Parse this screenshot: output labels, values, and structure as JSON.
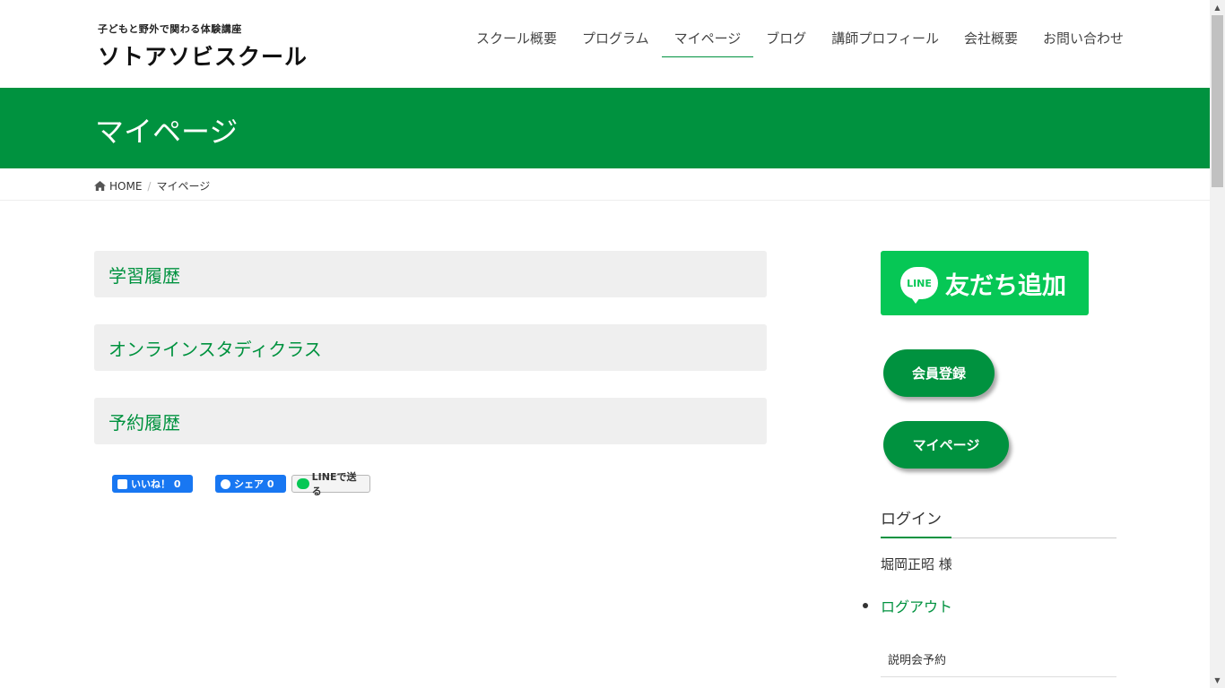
{
  "header": {
    "logo_sub": "子どもと野外で関わる体験講座",
    "logo_main": "ソトアソビスクール",
    "nav": [
      {
        "label": "スクール概要",
        "active": false
      },
      {
        "label": "プログラム",
        "active": false
      },
      {
        "label": "マイページ",
        "active": true
      },
      {
        "label": "ブログ",
        "active": false
      },
      {
        "label": "講師プロフィール",
        "active": false
      },
      {
        "label": "会社概要",
        "active": false
      },
      {
        "label": "お問い合わせ",
        "active": false
      }
    ]
  },
  "page_title": "マイページ",
  "breadcrumb": {
    "home": "HOME",
    "current": "マイページ"
  },
  "sections": [
    {
      "label": "学習履歴"
    },
    {
      "label": "オンラインスタディクラス"
    },
    {
      "label": "予約履歴"
    }
  ],
  "share": {
    "like_label": "いいね！ 0",
    "share_label": "シェア 0",
    "line_label": "LINEで送る"
  },
  "sidebar": {
    "line_icon_text": "LINE",
    "line_add_label": "友だち追加",
    "member_register_label": "会員登録",
    "mypage_label": "マイページ",
    "login_title": "ログイン",
    "user_name": "堀岡正昭 様",
    "logout_label": "ログアウト",
    "briefing_label": "説明会予約"
  },
  "colors": {
    "brand_green": "#00923f",
    "line_green": "#06c755",
    "facebook_blue": "#1877f2"
  },
  "icons": {
    "home": "home-icon",
    "like": "thumbs-up-icon",
    "share": "facebook-icon",
    "line": "line-icon"
  }
}
